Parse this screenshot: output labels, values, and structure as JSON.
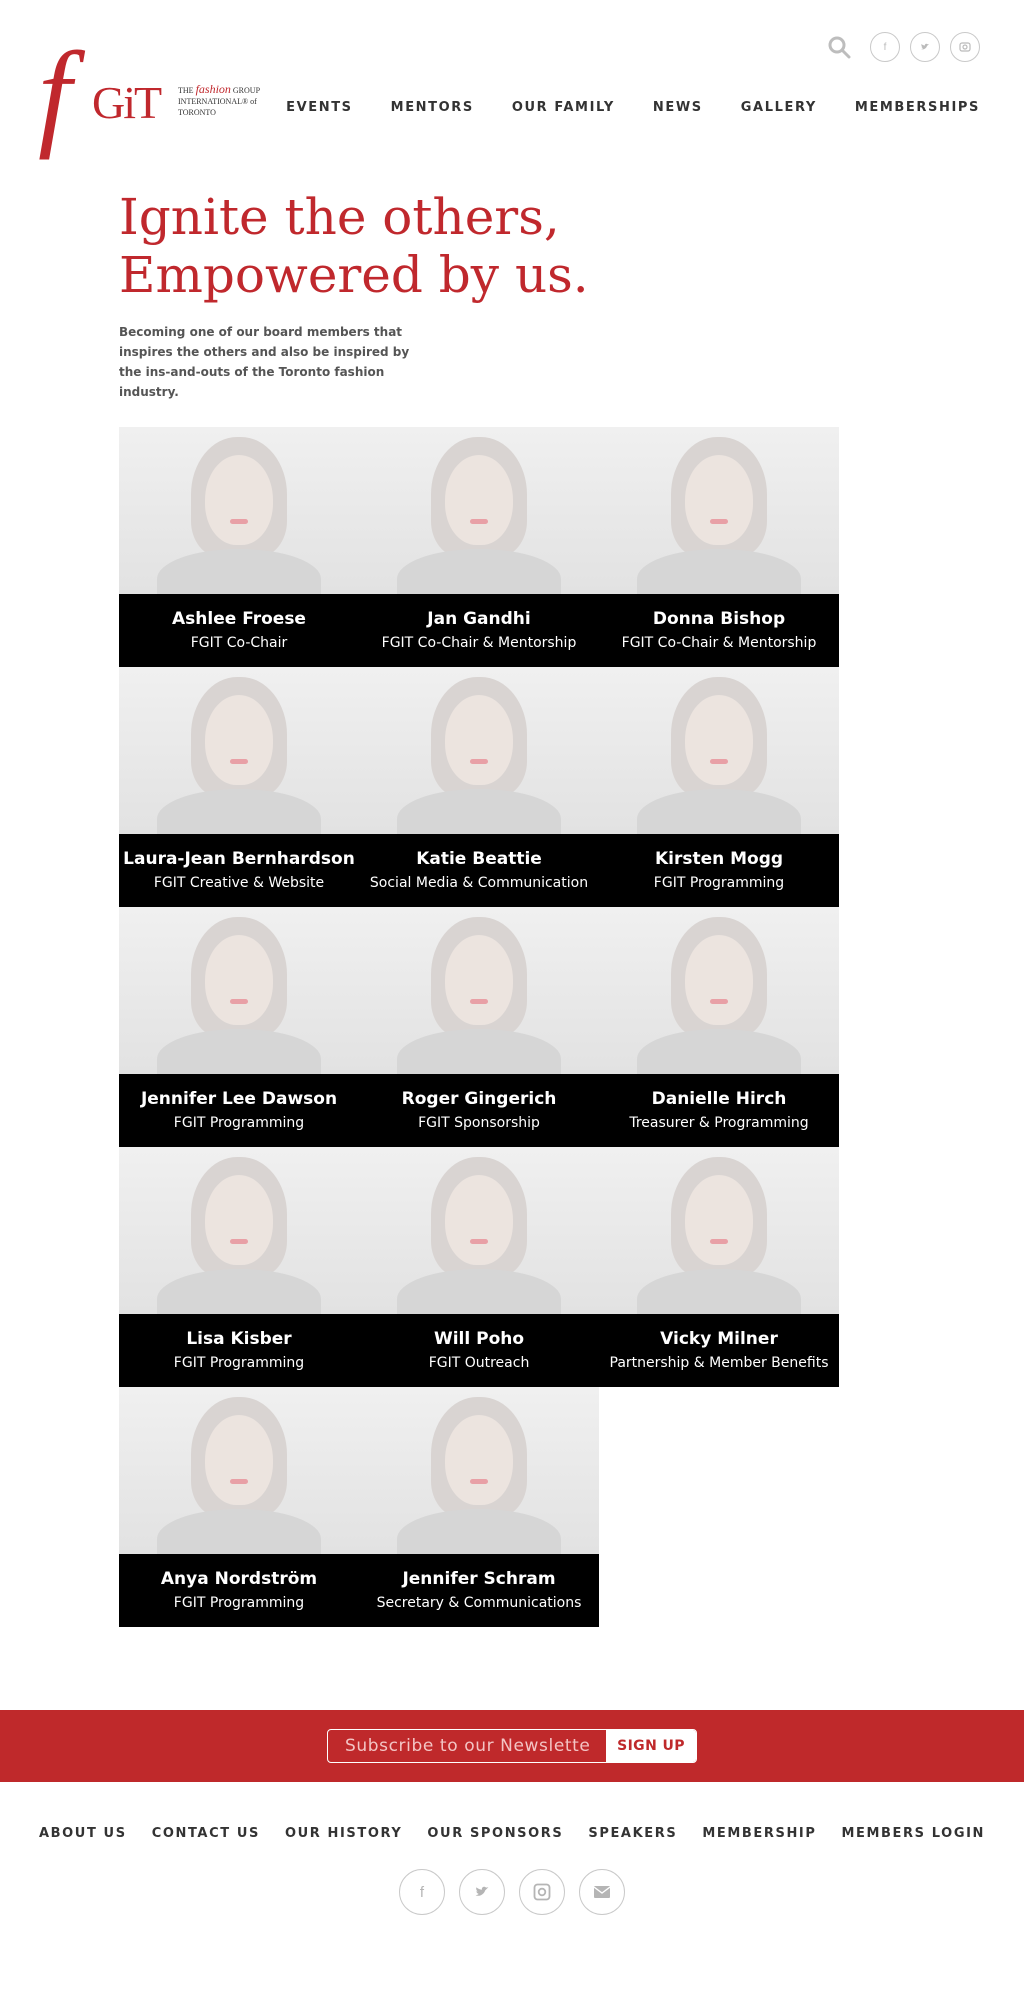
{
  "logo": {
    "mark": "fGIT",
    "line1_prefix": "THE",
    "line1_red": "fashion",
    "line1_suffix": "GROUP",
    "line2": "INTERNATIONAL® of",
    "line3": "TORONTO"
  },
  "utility": {
    "search_icon": "search-icon",
    "socials": [
      "facebook-icon",
      "twitter-icon",
      "instagram-icon"
    ]
  },
  "nav": [
    "EVENTS",
    "MENTORS",
    "OUR FAMILY",
    "NEWS",
    "GALLERY",
    "MEMBERSHIPS"
  ],
  "hero": {
    "line1": "Ignite the others,",
    "line2": "Empowered by us.",
    "body": "Becoming one of our board members that inspires the others and also be inspired by the ins-and-outs of the Toronto fashion industry."
  },
  "members": [
    {
      "name": "Ashlee Froese",
      "role": "FGIT Co-Chair"
    },
    {
      "name": "Jan Gandhi",
      "role": "FGIT Co-Chair  & Mentorship"
    },
    {
      "name": "Donna Bishop",
      "role": "FGIT Co-Chair & Mentorship"
    },
    {
      "name": "Laura-Jean Bernhardson",
      "role": "FGIT Creative & Website"
    },
    {
      "name": "Katie Beattie",
      "role": "Social Media & Communication"
    },
    {
      "name": "Kirsten Mogg",
      "role": "FGIT Programming"
    },
    {
      "name": "Jennifer Lee Dawson",
      "role": "FGIT Programming"
    },
    {
      "name": "Roger Gingerich",
      "role": "FGIT Sponsorship"
    },
    {
      "name": "Danielle Hirch",
      "role": "Treasurer  & Programming"
    },
    {
      "name": "Lisa Kisber",
      "role": "FGIT Programming"
    },
    {
      "name": "Will Poho",
      "role": "FGIT Outreach"
    },
    {
      "name": "Vicky Milner",
      "role": "Partnership & Member Benefits"
    },
    {
      "name": "Anya Nordström",
      "role": "FGIT Programming"
    },
    {
      "name": "Jennifer Schram",
      "role": "Secretary & Communications"
    }
  ],
  "newsletter": {
    "placeholder": "Subscribe to our Newsletter",
    "button": "SIGN UP"
  },
  "footer": {
    "links": [
      "ABOUT US",
      "CONTACT US",
      "OUR HISTORY",
      "OUR SPONSORS",
      "SPEAKERS",
      "MEMBERSHIP",
      "MEMBERS LOGIN"
    ],
    "socials": [
      "facebook-icon",
      "twitter-icon",
      "instagram-icon",
      "email-icon"
    ]
  },
  "colors": {
    "brand_red": "#bf292b",
    "caption_bg": "#000000"
  }
}
